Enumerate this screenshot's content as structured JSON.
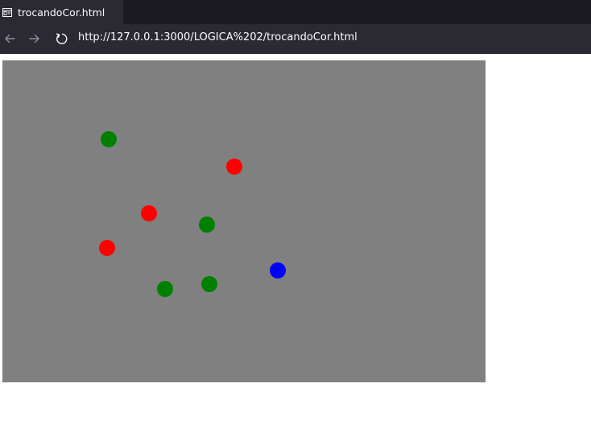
{
  "tab": {
    "title": "trocandoCor.html",
    "icon": "page-icon"
  },
  "navigation": {
    "back_icon": "back-arrow-icon",
    "forward_icon": "forward-arrow-icon",
    "reload_icon": "reload-icon",
    "url": "http://127.0.0.1:3000/LOGICA%202/trocandoCor.html"
  },
  "canvas": {
    "background_color": "#808080",
    "balls": [
      {
        "color": "green"
      },
      {
        "color": "red"
      },
      {
        "color": "red"
      },
      {
        "color": "green"
      },
      {
        "color": "red"
      },
      {
        "color": "blue"
      },
      {
        "color": "green"
      },
      {
        "color": "green"
      }
    ]
  }
}
